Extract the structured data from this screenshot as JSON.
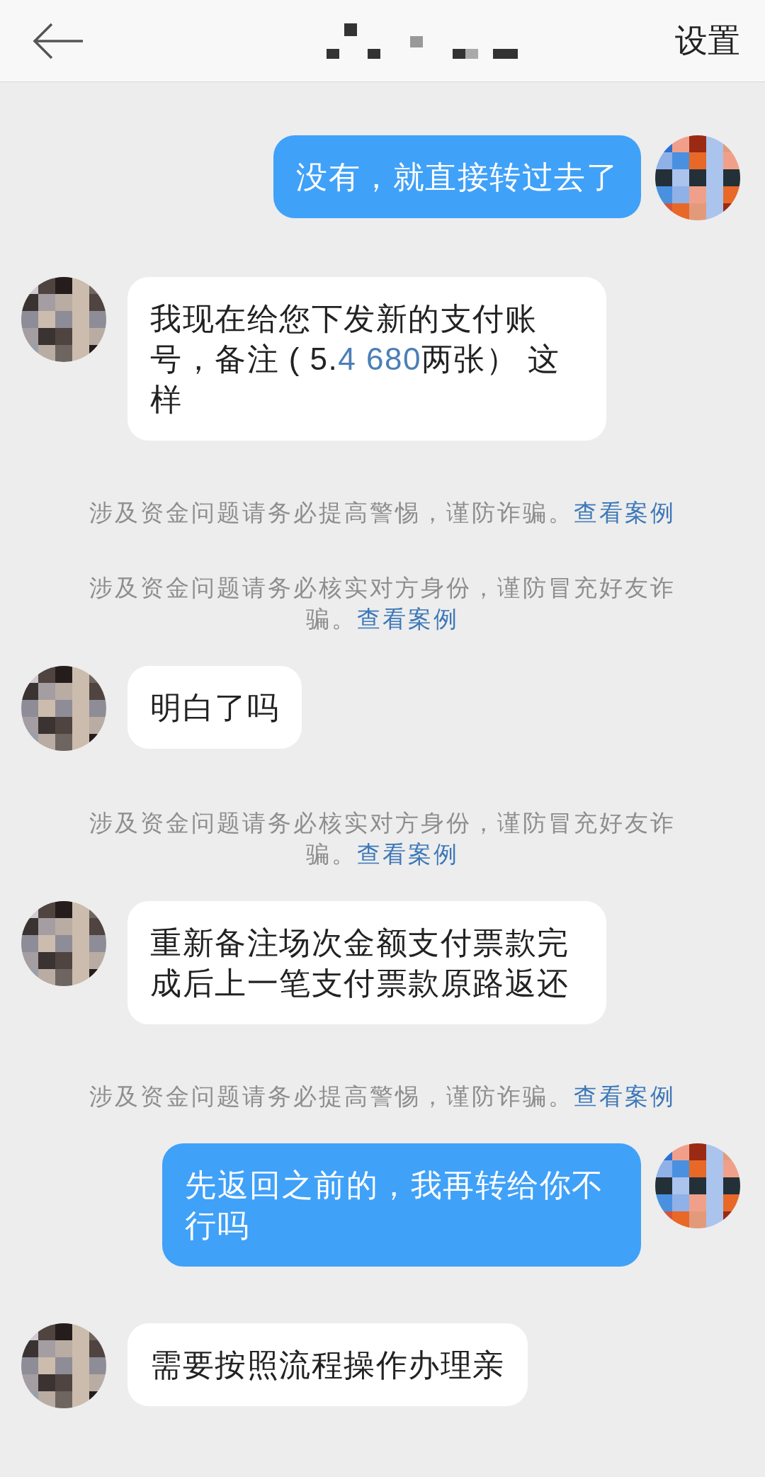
{
  "header": {
    "settings": "设置"
  },
  "messages": [
    {
      "kind": "outgoing",
      "parts": [
        {
          "text": "没有，就直接转过去了",
          "link": false
        }
      ]
    },
    {
      "kind": "incoming",
      "parts": [
        {
          "text": "我现在给您下发新的支付账号，备注 ( 5.",
          "link": false
        },
        {
          "text": "4 680",
          "link": true
        },
        {
          "text": "两张） 这样",
          "link": false
        }
      ]
    },
    {
      "kind": "notice",
      "text": "涉及资金问题请务必提高警惕，谨防诈骗。",
      "link": "查看案例"
    },
    {
      "kind": "notice",
      "text": "涉及资金问题请务必核实对方身份，谨防冒充好友诈骗。",
      "link": "查看案例"
    },
    {
      "kind": "incoming",
      "parts": [
        {
          "text": "明白了吗",
          "link": false
        }
      ]
    },
    {
      "kind": "notice",
      "text": "涉及资金问题请务必核实对方身份，谨防冒充好友诈骗。",
      "link": "查看案例"
    },
    {
      "kind": "incoming",
      "parts": [
        {
          "text": "重新备注场次金额支付票款完成后上一笔支付票款原路返还",
          "link": false
        }
      ]
    },
    {
      "kind": "notice",
      "text": "涉及资金问题请务必提高警惕，谨防诈骗。",
      "link": "查看案例"
    },
    {
      "kind": "outgoing",
      "parts": [
        {
          "text": "先返回之前的，我再转给你不行吗",
          "link": false
        }
      ]
    },
    {
      "kind": "incoming",
      "parts": [
        {
          "text": "需要按照流程操作办理亲",
          "link": false
        }
      ]
    }
  ]
}
